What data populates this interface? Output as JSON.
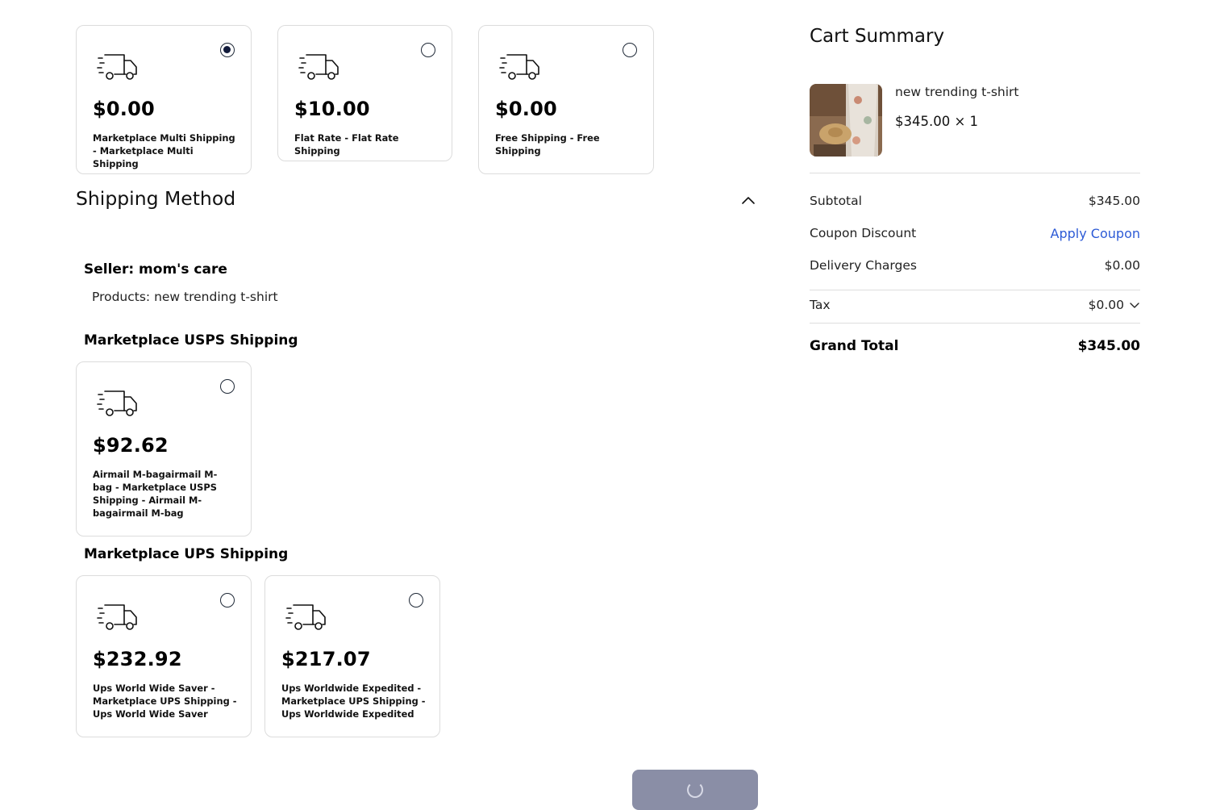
{
  "top_options": [
    {
      "price": "$0.00",
      "label": "Marketplace Multi Shipping - Marketplace Multi Shipping",
      "selected": true
    },
    {
      "price": "$10.00",
      "label": "Flat Rate - Flat Rate Shipping",
      "selected": false
    },
    {
      "price": "$0.00",
      "label": "Free Shipping - Free Shipping",
      "selected": false
    }
  ],
  "shipping_method": {
    "title": "Shipping Method",
    "seller": "Seller: mom's care",
    "products": "Products: new trending t-shirt",
    "usps": {
      "title": "Marketplace USPS Shipping",
      "options": [
        {
          "price": "$92.62",
          "label": "Airmail M-bagairmail M-bag - Marketplace USPS Shipping - Airmail M-bagairmail M-bag",
          "selected": false
        }
      ]
    },
    "ups": {
      "title": "Marketplace UPS Shipping",
      "options": [
        {
          "price": "$232.92",
          "label": "Ups World Wide Saver - Marketplace UPS Shipping - Ups World Wide Saver",
          "selected": false
        },
        {
          "price": "$217.07",
          "label": "Ups Worldwide Expedited - Marketplace UPS Shipping - Ups Worldwide Expedited",
          "selected": false
        }
      ]
    }
  },
  "cart_summary": {
    "title": "Cart Summary",
    "item": {
      "name": "new trending t-shirt",
      "price_qty": "$345.00 × 1"
    },
    "subtotal_label": "Subtotal",
    "subtotal_value": "$345.00",
    "coupon_label": "Coupon Discount",
    "coupon_action": "Apply Coupon",
    "delivery_label": "Delivery Charges",
    "delivery_value": "$0.00",
    "tax_label": "Tax",
    "tax_value": "$0.00",
    "grand_total_label": "Grand Total",
    "grand_total_value": "$345.00"
  },
  "colors": {
    "accent": "#121b3b",
    "link": "#2d5bd6",
    "button_disabled": "#8a8ea6"
  },
  "icons": [
    "truck-icon",
    "chevron-up-icon",
    "chevron-down-icon",
    "spinner-icon"
  ]
}
